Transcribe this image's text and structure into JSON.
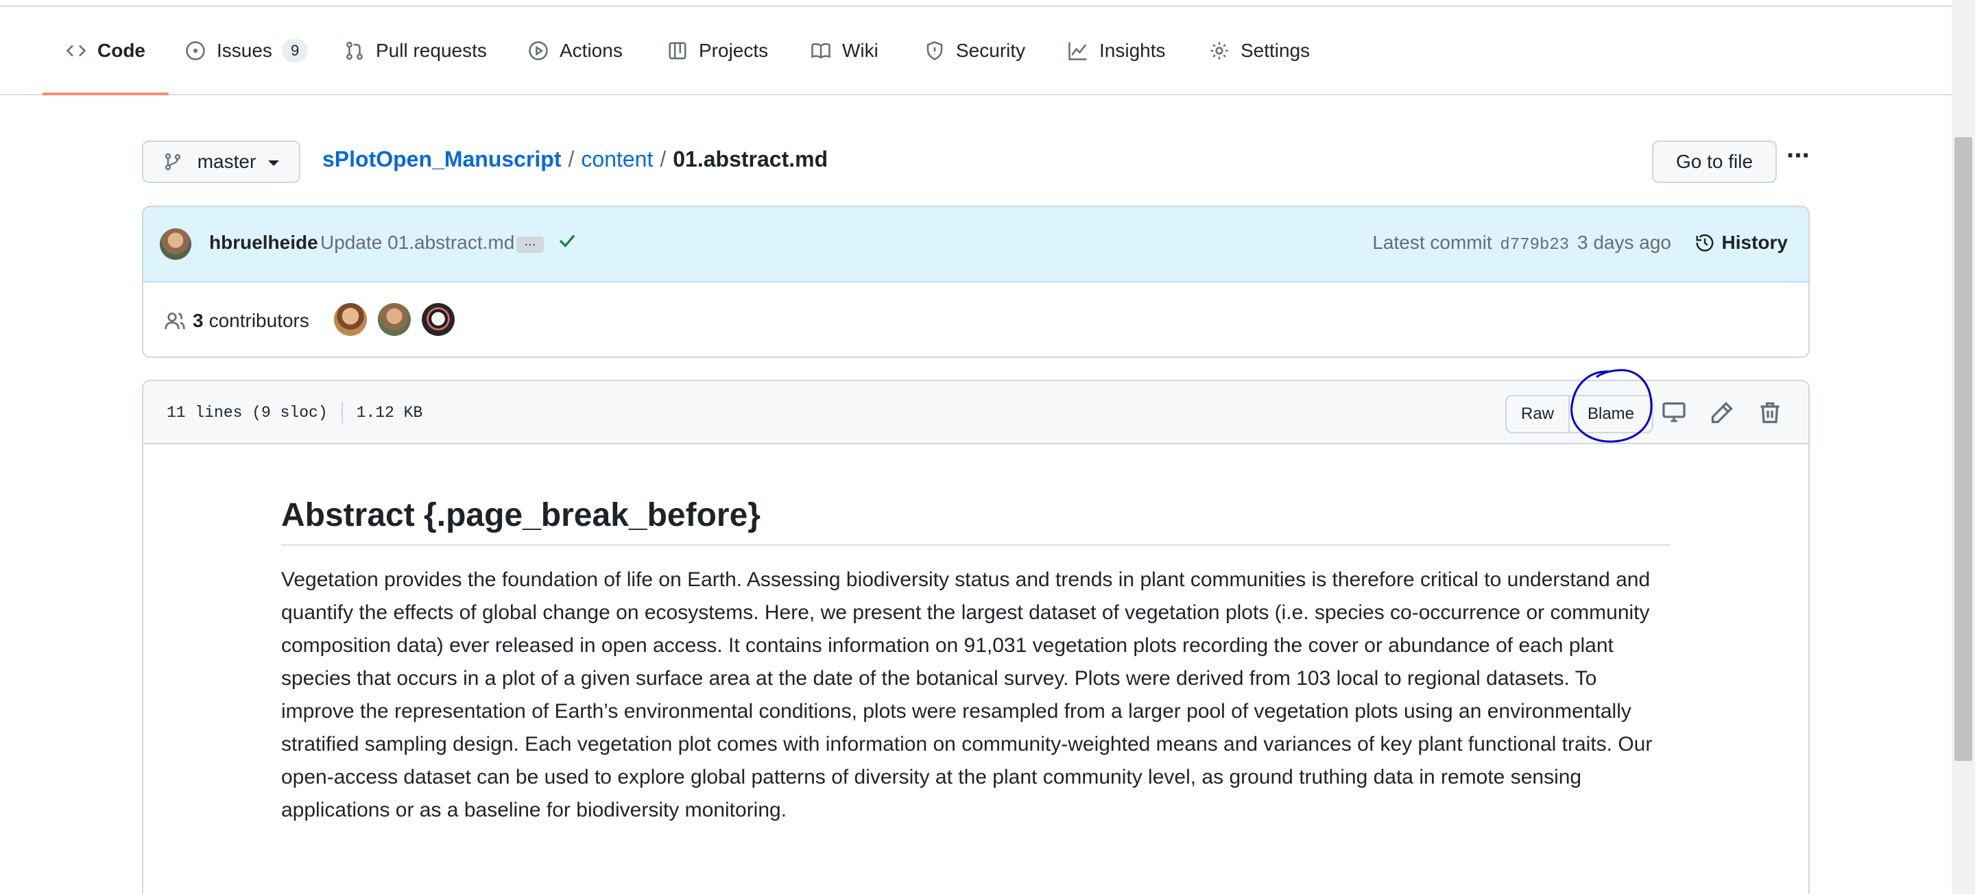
{
  "repo_nav": {
    "tabs": [
      {
        "label": "Code",
        "icon": "code-icon",
        "selected": true
      },
      {
        "label": "Issues",
        "icon": "issue-opened-icon",
        "count": "9"
      },
      {
        "label": "Pull requests",
        "icon": "git-pull-request-icon"
      },
      {
        "label": "Actions",
        "icon": "play-icon"
      },
      {
        "label": "Projects",
        "icon": "table-icon"
      },
      {
        "label": "Wiki",
        "icon": "book-icon"
      },
      {
        "label": "Security",
        "icon": "shield-icon"
      },
      {
        "label": "Insights",
        "icon": "graph-icon"
      },
      {
        "label": "Settings",
        "icon": "gear-icon"
      }
    ]
  },
  "file_nav": {
    "branch": "master",
    "breadcrumb": {
      "repo": "sPlotOpen_Manuscript",
      "folder": "content",
      "file": "01.abstract.md",
      "separator": "/"
    },
    "go_to_file": "Go to file",
    "more": "···"
  },
  "commit": {
    "author": "hbruelheide",
    "message": "Update 01.abstract.md",
    "ellipsis": "…",
    "status": "success",
    "latest_label": "Latest commit",
    "sha": "d779b23",
    "age": "3 days ago",
    "history": "History",
    "contributors_count": "3",
    "contributors_label": "contributors"
  },
  "file": {
    "lines": "11 lines (9 sloc)",
    "size": "1.12 KB",
    "raw": "Raw",
    "blame": "Blame",
    "icons": [
      "desktop-icon",
      "pencil-icon",
      "trash-icon"
    ]
  },
  "content": {
    "heading": "Abstract {.page_break_before}",
    "paragraph": "Vegetation provides the foundation of life on Earth. Assessing biodiversity status and trends in plant communities is therefore critical to understand and quantify the effects of global change on ecosystems. Here, we present the largest dataset of vegetation plots (i.e. species co-occurrence or community composition data) ever released in open access. It contains information on 91,031 vegetation plots recording the cover or abundance of each plant species that occurs in a plot of a given surface area at the date of the botanical survey. Plots were derived from 103 local to regional datasets. To improve the representation of Earth’s environmental conditions, plots were resampled from a larger pool of vegetation plots using an environmentally stratified sampling design. Each vegetation plot comes with information on community-weighted means and variances of key plant functional traits. Our open-access dataset can be used to explore global patterns of diversity at the plant community level, as ground truthing data in remote sensing applications or as a baseline for biodiversity monitoring."
  },
  "colors": {
    "accent_link": "#0969da",
    "tab_underline": "#fd8c73",
    "commit_bg": "#ddf4ff",
    "success": "#1a7f37",
    "annotation": "#0000cc"
  }
}
